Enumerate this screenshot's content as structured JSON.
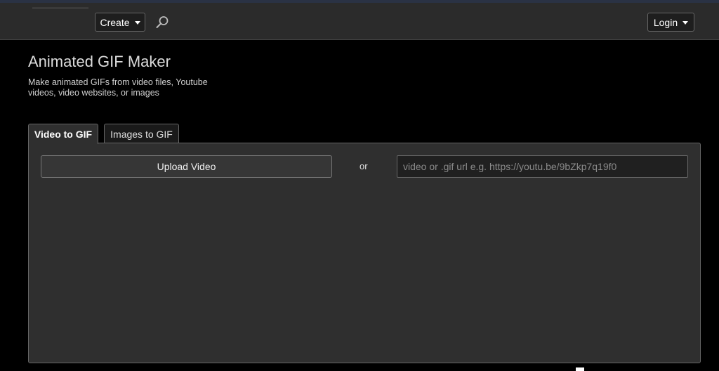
{
  "header": {
    "create_label": "Create",
    "login_label": "Login",
    "icons": {
      "search": "search-icon",
      "dropdown": "chevron-down-icon"
    }
  },
  "page": {
    "title": "Animated GIF Maker",
    "subtitle": "Make animated GIFs from video files, Youtube videos, video websites, or images"
  },
  "tabs": [
    {
      "label": "Video to GIF",
      "active": true
    },
    {
      "label": "Images to GIF",
      "active": false
    }
  ],
  "upload": {
    "button_label": "Upload Video",
    "or_label": "or",
    "url_placeholder": "video or .gif url e.g. https://youtu.be/9bZkp7q19f0",
    "url_value": ""
  },
  "colors": {
    "background": "#000000",
    "navbar": "#2b2b2b",
    "panel": "#2f2f2f",
    "border": "#666666"
  }
}
